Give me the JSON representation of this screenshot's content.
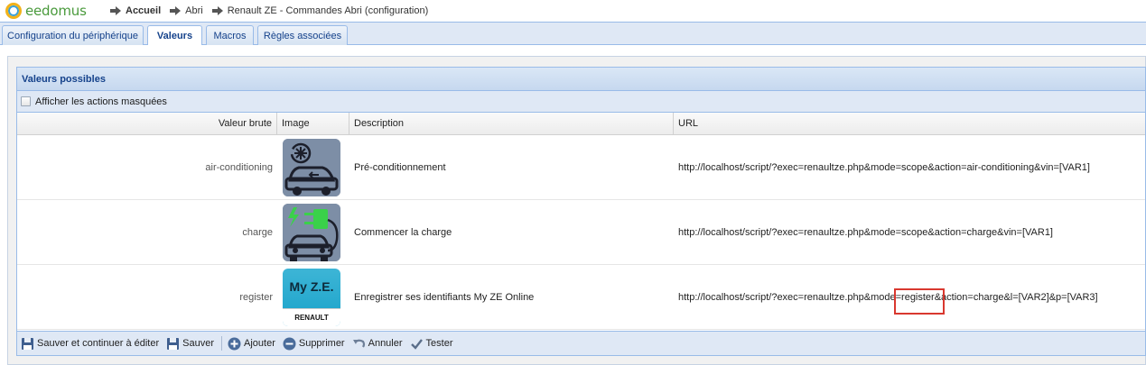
{
  "app": {
    "logo_text": "eedomus"
  },
  "breadcrumb": [
    {
      "label": "Accueil",
      "bold": true
    },
    {
      "label": "Abri",
      "bold": false
    },
    {
      "label": "Renault ZE - Commandes Abri (configuration)",
      "bold": false
    }
  ],
  "tabs": [
    {
      "label": "Configuration du périphérique",
      "active": false
    },
    {
      "label": "Valeurs",
      "active": true
    },
    {
      "label": "Macros",
      "active": false
    },
    {
      "label": "Règles associées",
      "active": false
    }
  ],
  "panel": {
    "title": "Valeurs possibles",
    "show_hidden_label": "Afficher les actions masquées",
    "show_hidden_checked": false
  },
  "grid": {
    "columns": [
      "Valeur brute",
      "Image",
      "Description",
      "URL"
    ],
    "rows": [
      {
        "raw": "air-conditioning",
        "image_icon": "car-air-conditioning-icon",
        "description": "Pré-conditionnement",
        "url": "http://localhost/script/?exec=renaultze.php&mode=scope&action=air-conditioning&vin=[VAR1]"
      },
      {
        "raw": "charge",
        "image_icon": "car-charging-plug-icon",
        "description": "Commencer la charge",
        "url": "http://localhost/script/?exec=renaultze.php&mode=scope&action=charge&vin=[VAR1]"
      },
      {
        "raw": "register",
        "image_icon": "my-ze-renault-logo",
        "image_text_top": "My Z.E.",
        "image_text_bottom": "RENAULT",
        "description": "Enregistrer ses identifiants My ZE Online",
        "url": "http://localhost/script/?exec=renaultze.php&mode=register&action=charge&l=[VAR2]&p=[VAR3]"
      }
    ]
  },
  "toolbar": {
    "save_continue": "Sauver et continuer à éditer",
    "save": "Sauver",
    "add": "Ajouter",
    "delete": "Supprimer",
    "cancel": "Annuler",
    "test": "Tester"
  },
  "colors": {
    "highlight_box": "#d9382f",
    "header_text": "#15428b",
    "tab_strip": "#dfe8f5"
  }
}
